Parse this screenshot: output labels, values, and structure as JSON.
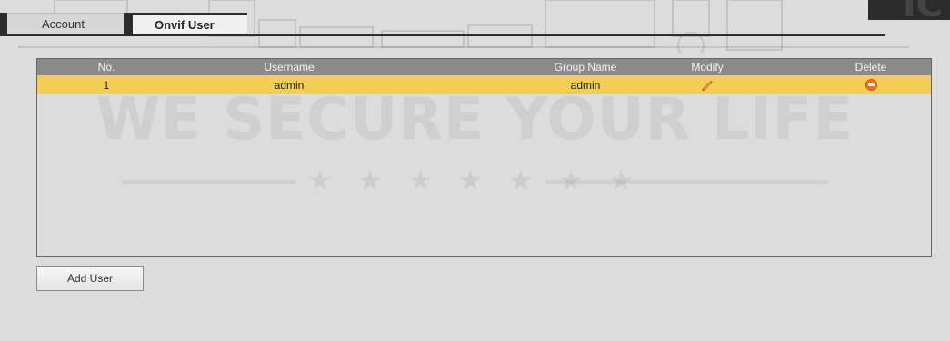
{
  "tabs": [
    {
      "label": "Account",
      "active": false
    },
    {
      "label": "Onvif User",
      "active": true
    }
  ],
  "watermark": {
    "slogan": "WE SECURE YOUR LIFE",
    "stars": "★ ★ ★ ★ ★ ★ ★",
    "corner": "IC"
  },
  "table": {
    "headers": {
      "no": "No.",
      "username": "Username",
      "group": "Group Name",
      "modify": "Modify",
      "delete": "Delete"
    },
    "rows": [
      {
        "no": "1",
        "username": "admin",
        "group": "admin"
      }
    ],
    "colors": {
      "header_bg": "#8a8a8a",
      "selected_row": "#f2cf52",
      "delete_icon": "#f07020"
    }
  },
  "actions": {
    "add_user_label": "Add User"
  },
  "icons": {
    "modify": "pencil-icon",
    "delete": "delete-icon"
  }
}
